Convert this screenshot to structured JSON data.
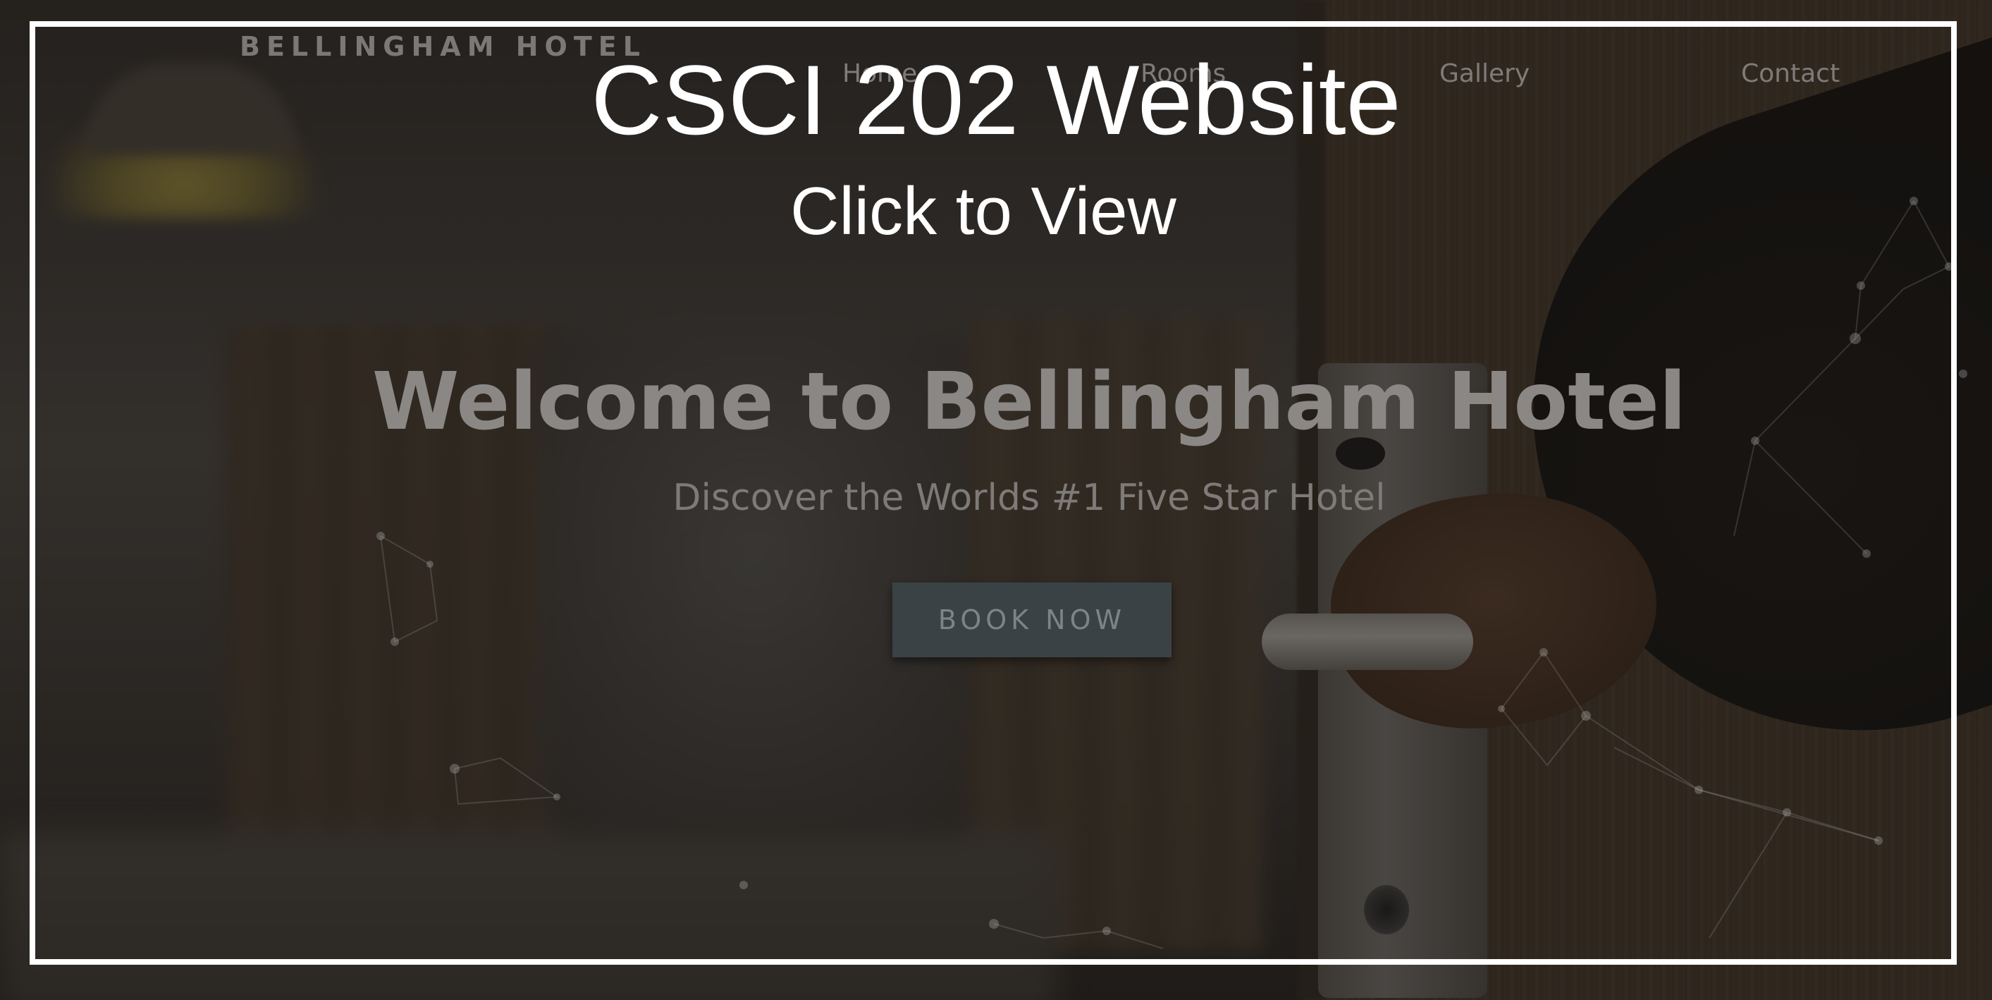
{
  "overlay_card": {
    "title": "CSCI 202 Website",
    "subtitle": "Click to View"
  },
  "site": {
    "brand": "BELLINGHAM HOTEL",
    "nav": [
      {
        "label": "Home"
      },
      {
        "label": "Rooms"
      },
      {
        "label": "Gallery"
      },
      {
        "label": "Contact"
      }
    ],
    "hero": {
      "title": "Welcome to Bellingham Hotel",
      "subtitle": "Discover the Worlds #1 Five Star Hotel",
      "cta_label": "BOOK NOW"
    }
  },
  "colors": {
    "frame": "#ffffff",
    "overlay_text": "#ffffff",
    "button_bg": "#3b4245"
  }
}
